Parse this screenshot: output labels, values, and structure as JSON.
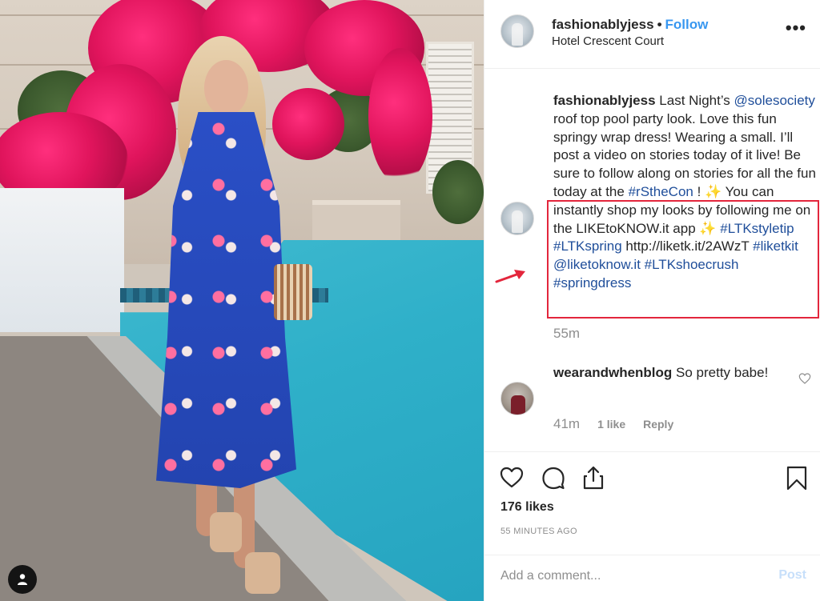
{
  "post": {
    "username": "fashionablyjess",
    "follow_label": "Follow",
    "separator": "•",
    "location": "Hotel Crescent Court",
    "more_label": "•••",
    "image_alt": "Woman in blue floral wrap dress by a pool with bougainvillea"
  },
  "caption": {
    "username": "fashionablyjess",
    "segments": [
      {
        "t": "text",
        "v": " Last Night’s "
      },
      {
        "t": "tag",
        "v": "@solesociety"
      },
      {
        "t": "text",
        "v": " roof top pool party look. Love this fun springy wrap dress! Wearing a small. I’ll post a video on stories today of it live! Be sure to follow along on stories for all the fun today at the "
      },
      {
        "t": "tag",
        "v": "#rStheCon"
      },
      {
        "t": "text",
        "v": " ! "
      },
      {
        "t": "spark",
        "v": "✨"
      },
      {
        "t": "text",
        "v": "  You can instantly shop my looks by following me on the LIKEtoKNOW.it app "
      },
      {
        "t": "spark",
        "v": "✨"
      },
      {
        "t": "text",
        "v": "  "
      },
      {
        "t": "tag",
        "v": "#LTKstyletip"
      },
      {
        "t": "text",
        "v": " "
      },
      {
        "t": "tag",
        "v": "#LTKspring"
      },
      {
        "t": "text",
        "v": " http://liketk.it/2AWzT "
      },
      {
        "t": "tag",
        "v": "#liketkit"
      },
      {
        "t": "text",
        "v": " "
      },
      {
        "t": "tag",
        "v": "@liketoknow.it"
      },
      {
        "t": "text",
        "v": " "
      },
      {
        "t": "tag",
        "v": "#LTKshoecrush"
      },
      {
        "t": "text",
        "v": " "
      },
      {
        "t": "tag",
        "v": "#springdress"
      }
    ],
    "time": "55m"
  },
  "comments": [
    {
      "username": "wearandwhenblog",
      "text": " So pretty babe!",
      "time": "41m",
      "likes": "1 like",
      "reply_label": "Reply"
    }
  ],
  "actions": {
    "likes": "176 likes",
    "posted_ago": "55 MINUTES AGO"
  },
  "add_comment": {
    "placeholder": "Add a comment...",
    "value": "",
    "post_label": "Post"
  },
  "annotation": {
    "highlight_color": "#e3263c"
  },
  "colors": {
    "link": "#3897f0",
    "hashtag": "#1f4e9a",
    "muted": "#8e8e8e",
    "post_disabled": "#c7dffa"
  }
}
